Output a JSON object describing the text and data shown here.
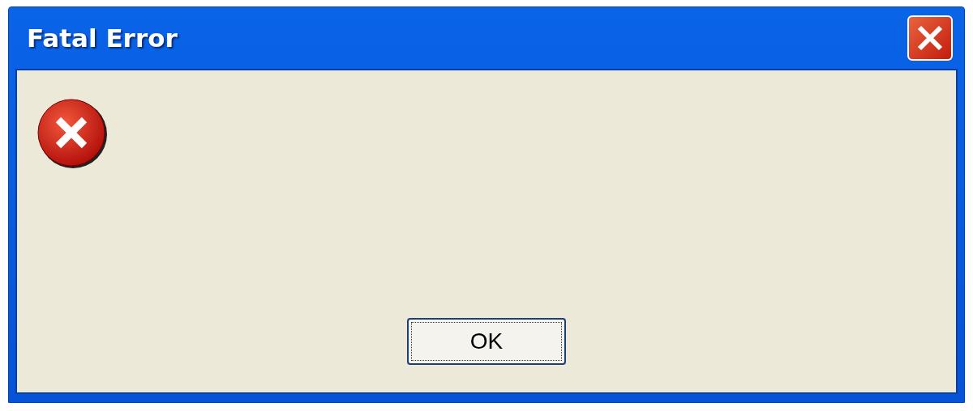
{
  "window": {
    "title": "Fatal Error"
  },
  "buttons": [
    {
      "label": "OK",
      "focused": true
    }
  ]
}
